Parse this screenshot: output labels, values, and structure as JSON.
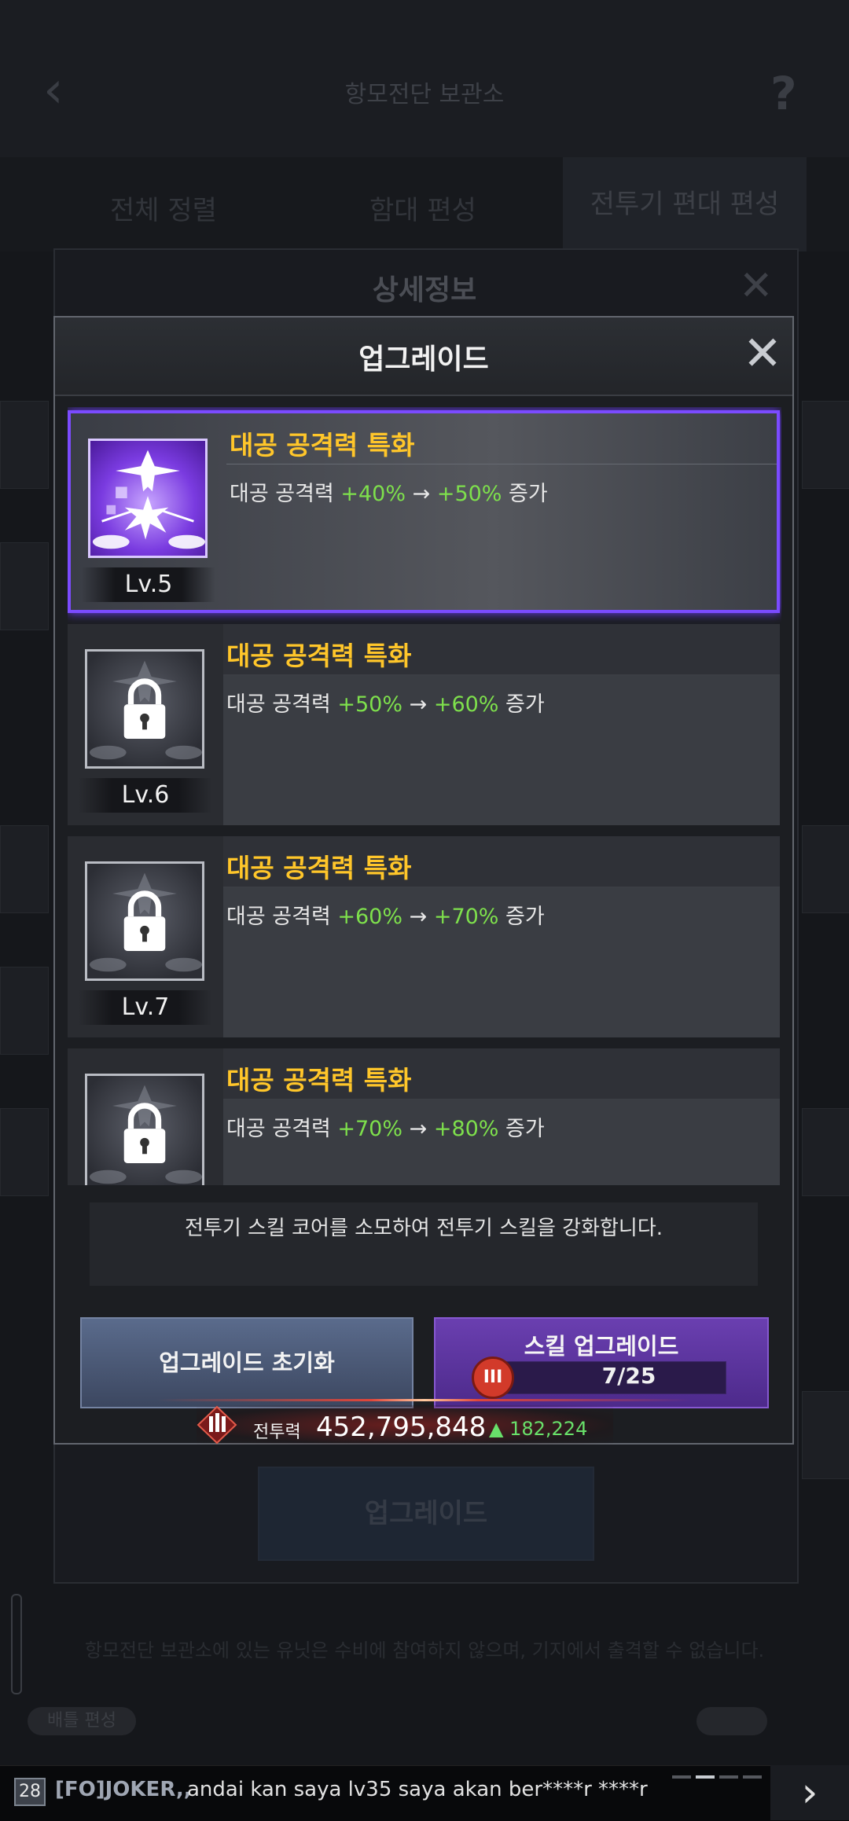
{
  "background": {
    "title": "항모전단 보관소",
    "tabs": [
      "전체 정렬",
      "함대 편성",
      "전투기 편대 편성"
    ],
    "panel_title": "상세정보",
    "upgrade_button": "업그레이드",
    "footnote": "항모전단 보관소에 있는 유닛은 수비에 참여하지 않으며, 기지에서 출격할 수 없습니다.",
    "pill_label": "배틀 편성"
  },
  "modal": {
    "title": "업그레이드",
    "close_icon": "close-icon"
  },
  "skills": [
    {
      "name": "대공 공격력 특화",
      "desc_prefix": "대공 공격력 ",
      "from": "+40%",
      "arrow": "→",
      "to": "+50%",
      "desc_suffix": " 증가",
      "level": "Lv.5",
      "state": "unlocked"
    },
    {
      "name": "대공 공격력 특화",
      "desc_prefix": "대공 공격력 ",
      "from": "+50%",
      "arrow": "→",
      "to": "+60%",
      "desc_suffix": " 증가",
      "level": "Lv.6",
      "state": "locked"
    },
    {
      "name": "대공 공격력 특화",
      "desc_prefix": "대공 공격력 ",
      "from": "+60%",
      "arrow": "→",
      "to": "+70%",
      "desc_suffix": " 증가",
      "level": "Lv.7",
      "state": "locked"
    },
    {
      "name": "대공 공격력 특화",
      "desc_prefix": "대공 공격력 ",
      "from": "+70%",
      "arrow": "→",
      "to": "+80%",
      "desc_suffix": " 증가",
      "level": "",
      "state": "locked"
    }
  ],
  "info_text": "전투기 스킬 코어를 소모하여 전투기 스킬을 강화합니다.",
  "buttons": {
    "reset": "업그레이드 초기화",
    "skill_upgrade": "스킬 업그레이드",
    "cost_icon_label": "III",
    "cost": "7/25"
  },
  "power": {
    "label": "전투력",
    "value": "452,795,848",
    "delta": "▲ 182,224"
  },
  "chat": {
    "channel": "28",
    "sender": "[FO]JOKER,,",
    "message": "andai kan saya lv35 saya akan ber****r ****r",
    "next_icon": "›"
  },
  "colors": {
    "skill_name": "#ffc62a",
    "value_green": "#7ee04c",
    "active_border": "#7b4bff",
    "reset_button": "#4c5a78",
    "skill_button": "#5c35a0",
    "power_delta": "#68e06a"
  }
}
